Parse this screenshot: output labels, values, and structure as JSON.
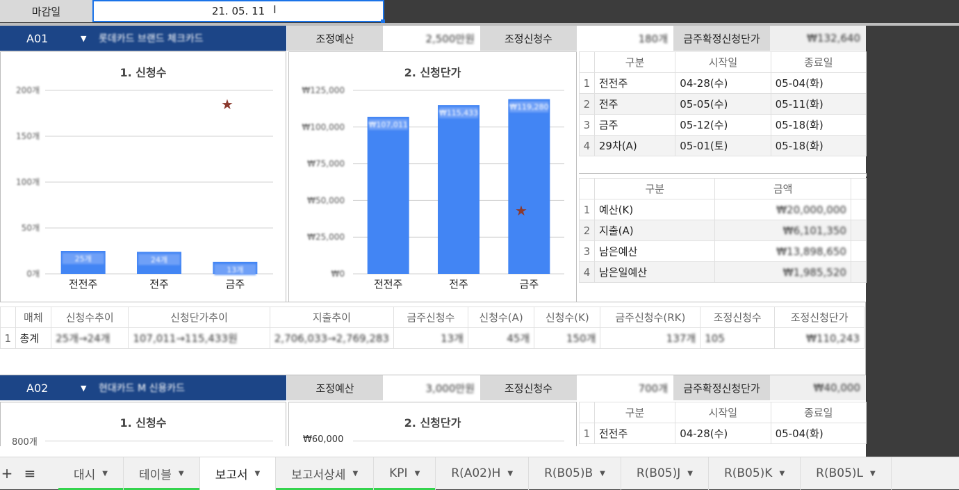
{
  "header": {
    "deadline_label": "마감일",
    "deadline_value": "21. 05. 11"
  },
  "sections": [
    {
      "code": "A01",
      "name": "롯데카드 브랜드 체크카드",
      "adj_budget_label": "조정예산",
      "adj_budget_value": "2,500만원",
      "adj_count_label": "조정신청수",
      "adj_count_value": "180개",
      "confirmed_price_label": "금주확정신청단가",
      "confirmed_price_value": "₩132,640"
    },
    {
      "code": "A02",
      "name": "현대카드 M 신용카드",
      "adj_budget_label": "조정예산",
      "adj_budget_value": "3,000만원",
      "adj_count_label": "조정신청수",
      "adj_count_value": "700개",
      "confirmed_price_label": "금주확정신청단가",
      "confirmed_price_value": "₩40,000"
    }
  ],
  "chart_data": [
    {
      "type": "bar",
      "title": "1. 신청수",
      "categories": [
        "전전주",
        "전주",
        "금주"
      ],
      "values": [
        25,
        24,
        13
      ],
      "data_labels": [
        "25개",
        "24개",
        "13개"
      ],
      "ylim": [
        0,
        200
      ],
      "yticks": [
        "0개",
        "50개",
        "100개",
        "150개",
        "200개"
      ],
      "target_marker": 185,
      "bar_color": "#4285f4",
      "marker_color": "#8b3a2e"
    },
    {
      "type": "bar",
      "title": "2. 신청단가",
      "categories": [
        "전전주",
        "전주",
        "금주"
      ],
      "values": [
        107000,
        115000,
        119000
      ],
      "data_labels": [
        "₩107,011",
        "₩115,433",
        "₩119,280"
      ],
      "ylim": [
        0,
        125000
      ],
      "yticks": [
        "₩0",
        "₩25,000",
        "₩50,000",
        "₩75,000",
        "₩100,000",
        "₩125,000"
      ],
      "target_marker": 43000,
      "bar_color": "#4285f4",
      "marker_color": "#8b3a2e"
    },
    {
      "type": "bar",
      "title": "1. 신청수",
      "categories": [],
      "values": [],
      "yticks": [
        "800개"
      ]
    },
    {
      "type": "bar",
      "title": "2. 신청단가",
      "categories": [],
      "values": [],
      "yticks": [
        "₩60,000"
      ]
    }
  ],
  "period_table": {
    "headers": [
      "구분",
      "시작일",
      "종료일"
    ],
    "rows": [
      [
        "1",
        "전전주",
        "04-28(수)",
        "05-04(화)"
      ],
      [
        "2",
        "전주",
        "05-05(수)",
        "05-11(화)"
      ],
      [
        "3",
        "금주",
        "05-12(수)",
        "05-18(화)"
      ],
      [
        "4",
        "29차(A)",
        "05-01(토)",
        "05-18(화)"
      ]
    ]
  },
  "period_table_2": {
    "headers": [
      "구분",
      "시작일",
      "종료일"
    ],
    "rows": [
      [
        "1",
        "전전주",
        "04-28(수)",
        "05-04(화)"
      ]
    ]
  },
  "amount_table": {
    "headers": [
      "구분",
      "금액"
    ],
    "rows": [
      [
        "1",
        "예산(K)",
        "₩20,000,000"
      ],
      [
        "2",
        "지출(A)",
        "₩6,101,350"
      ],
      [
        "3",
        "남은예산",
        "₩13,898,650"
      ],
      [
        "4",
        "남은일예산",
        "₩1,985,520"
      ]
    ]
  },
  "summary_table": {
    "headers": [
      "매체",
      "신청수추이",
      "신청단가추이",
      "지출추이",
      "금주신청수",
      "신청수(A)",
      "신청수(K)",
      "금주신청수(RK)",
      "조정신청수",
      "조정신청단가"
    ],
    "rows": [
      [
        "1",
        "총계",
        "25개→24개",
        "107,011→115,433원",
        "2,706,033→2,769,283",
        "13개",
        "45개",
        "150개",
        "137개",
        "105",
        "₩110,243"
      ]
    ]
  },
  "tabs": [
    {
      "label": "대시",
      "active": false,
      "green": true
    },
    {
      "label": "테이블",
      "active": false,
      "green": true
    },
    {
      "label": "보고서",
      "active": true,
      "green": false
    },
    {
      "label": "보고서상세",
      "active": false,
      "green": true
    },
    {
      "label": "KPI",
      "active": false,
      "green": true
    },
    {
      "label": "R(A02)H",
      "active": false,
      "green": false
    },
    {
      "label": "R(B05)B",
      "active": false,
      "green": false
    },
    {
      "label": "R(B05)J",
      "active": false,
      "green": false
    },
    {
      "label": "R(B05)K",
      "active": false,
      "green": false
    },
    {
      "label": "R(B05)L",
      "active": false,
      "green": false
    }
  ],
  "tab_buttons": {
    "add": "+",
    "menu": "≡"
  },
  "icons": {
    "dropdown": "caret-down-icon",
    "cursor": "text-cursor-icon",
    "star": "star-icon"
  }
}
